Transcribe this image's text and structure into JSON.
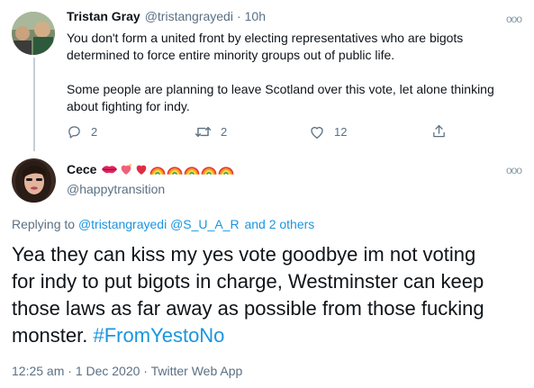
{
  "tweet": {
    "author_name": "Tristan Gray",
    "handle": "@tristangrayedi",
    "separator": "·",
    "time": "10h",
    "text_lines": [
      "You don't form a united front by electing representatives who are bigots",
      "determined to force entire minority groups out of public life.",
      "Some people are planning to leave Scotland over this vote, let alone thinking",
      "about fighting for indy."
    ],
    "replies": "2",
    "retweets": "2",
    "likes": "12",
    "more_label": "ooo"
  },
  "reply": {
    "author_name": "Cece",
    "handle": "@happytransition",
    "more_label": "ooo",
    "name_emojis": [
      "kiss-lips",
      "heart-sparkle",
      "red-heart",
      "rainbow",
      "rainbow",
      "rainbow",
      "rainbow",
      "rainbow"
    ],
    "replying_prefix": "Replying to",
    "replying_users": [
      "@tristangrayedi",
      "@S_U_A_R"
    ],
    "replying_suffix": "and 2 others",
    "text_lines": [
      "Yea they can kiss my yes vote goodbye im not voting",
      "for indy to put bigots in charge, Westminster can keep",
      "those laws as far away as possible from those fucking"
    ],
    "last_line_text": "monster.",
    "hashtag": "#FromYestoNo",
    "timestamp": "12:25 am · 1 Dec 2020 · Twitter Web App"
  },
  "colors": {
    "link_blue": "#1b95e0",
    "muted_gray": "#5b7083",
    "thread_line": "#c4cfd6"
  }
}
